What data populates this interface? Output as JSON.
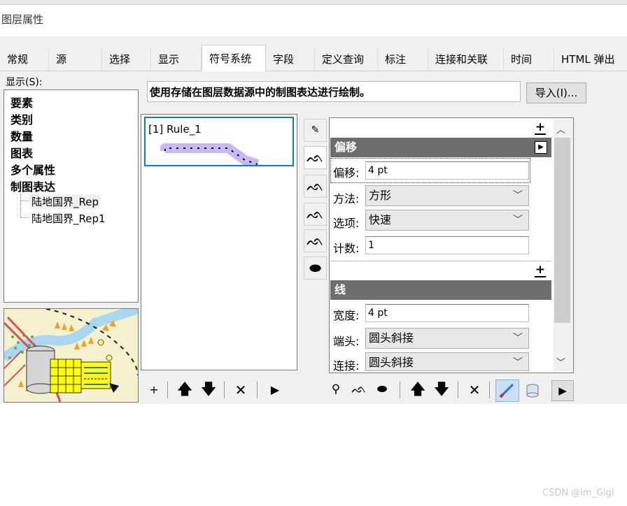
{
  "window": {
    "title": "图层属性"
  },
  "tabs": [
    {
      "label": "常规"
    },
    {
      "label": "源"
    },
    {
      "label": "选择"
    },
    {
      "label": "显示"
    },
    {
      "label": "符号系统",
      "active": true
    },
    {
      "label": "字段"
    },
    {
      "label": "定义查询"
    },
    {
      "label": "标注"
    },
    {
      "label": "连接和关联"
    },
    {
      "label": "时间"
    },
    {
      "label": "HTML 弹出"
    }
  ],
  "show": {
    "label": "显示(S):",
    "categories": [
      "要素",
      "类别",
      "数量",
      "图表",
      "多个属性",
      "制图表达"
    ],
    "representations": [
      "陆地国界_Rep",
      "陆地国界_Rep1"
    ]
  },
  "description": "使用存储在图层数据源中的制图表达进行绘制。",
  "import_button": "导入(I)...",
  "rules": [
    {
      "label": "[1] Rule_1"
    }
  ],
  "toolbar_left": {
    "add": "+",
    "up": "🡅",
    "down": "🡇",
    "remove": "✕",
    "more": "▶"
  },
  "layers": {
    "icons": [
      "pick-icon",
      "stroke-icon",
      "stroke-icon",
      "stroke-icon",
      "stroke-icon",
      "fill-icon"
    ]
  },
  "properties": {
    "offset": {
      "header": "偏移",
      "rows": [
        {
          "label": "偏移:",
          "value": "4 pt",
          "type": "input"
        },
        {
          "label": "方法:",
          "value": "方形",
          "type": "select"
        },
        {
          "label": "选项:",
          "value": "快速",
          "type": "select"
        },
        {
          "label": "计数:",
          "value": "1",
          "type": "input"
        }
      ]
    },
    "stroke": {
      "header": "线",
      "rows": [
        {
          "label": "宽度:",
          "value": "4 pt",
          "type": "input"
        },
        {
          "label": "端头:",
          "value": "圆头斜接",
          "type": "select"
        },
        {
          "label": "连接:",
          "value": "圆头斜接",
          "type": "select"
        }
      ]
    }
  },
  "toolbar_right": {
    "up": "🡅",
    "down": "🡇",
    "remove": "✕",
    "more": "▶"
  },
  "watermark": "CSDN @im_Gigi"
}
